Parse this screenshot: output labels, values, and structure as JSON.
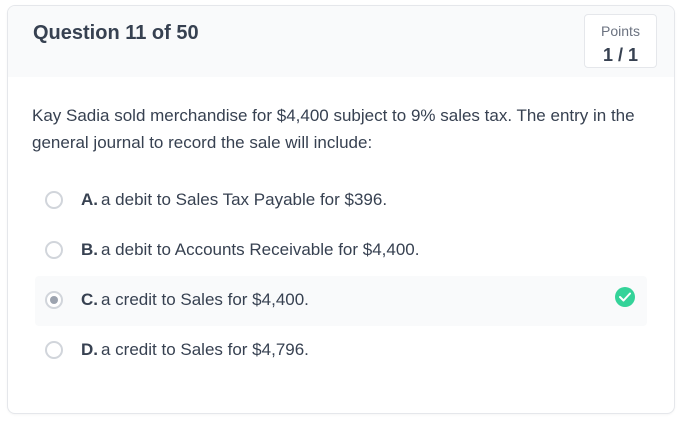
{
  "question": {
    "number_label": "Question 11 of 50",
    "text": "Kay Sadia sold merchandise for $4,400 subject to 9% sales tax. The entry in the general journal to record the sale will include:"
  },
  "points": {
    "label": "Points",
    "value": "1 / 1"
  },
  "options": [
    {
      "letter": "A.",
      "text": "a debit to Sales Tax Payable for $396.",
      "selected": false,
      "correct": false
    },
    {
      "letter": "B.",
      "text": "a debit to Accounts Receivable for $4,400.",
      "selected": false,
      "correct": false
    },
    {
      "letter": "C.",
      "text": "a credit to Sales for $4,400.",
      "selected": true,
      "correct": true
    },
    {
      "letter": "D.",
      "text": "a credit to Sales for $4,796.",
      "selected": false,
      "correct": false
    }
  ],
  "icons": {
    "correct": "check-circle-icon"
  },
  "colors": {
    "correct_accent": "#34d399",
    "header_bg": "#f9fafb",
    "text": "#374151"
  }
}
